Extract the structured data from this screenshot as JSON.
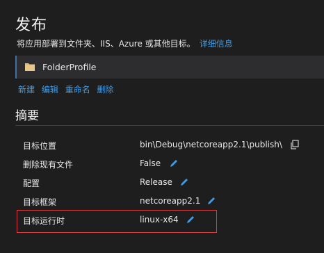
{
  "header": {
    "title": "发布",
    "description": "将应用部署到文件夹、IIS、Azure 或其他目标。",
    "details_link": "详细信息"
  },
  "profile": {
    "name": "FolderProfile",
    "icon": "folder-icon",
    "icon_color": "#dcb67a"
  },
  "actions": {
    "new": "新建",
    "edit": "编辑",
    "rename": "重命名",
    "delete": "删除"
  },
  "summary": {
    "title": "摘要",
    "rows": [
      {
        "key": "目标位置",
        "value": "bin\\Debug\\netcoreapp2.1\\publish\\",
        "action_icon": "copy-icon"
      },
      {
        "key": "删除现有文件",
        "value": "False",
        "action_icon": "pencil-icon"
      },
      {
        "key": "配置",
        "value": "Release",
        "action_icon": "pencil-icon"
      },
      {
        "key": "目标框架",
        "value": "netcoreapp2.1",
        "action_icon": "pencil-icon"
      },
      {
        "key": "目标运行时",
        "value": "linux-x64",
        "action_icon": "pencil-icon"
      }
    ]
  },
  "colors": {
    "background": "#1e1e1e",
    "link": "#3f9ce8",
    "highlight_border": "#d9393f"
  }
}
